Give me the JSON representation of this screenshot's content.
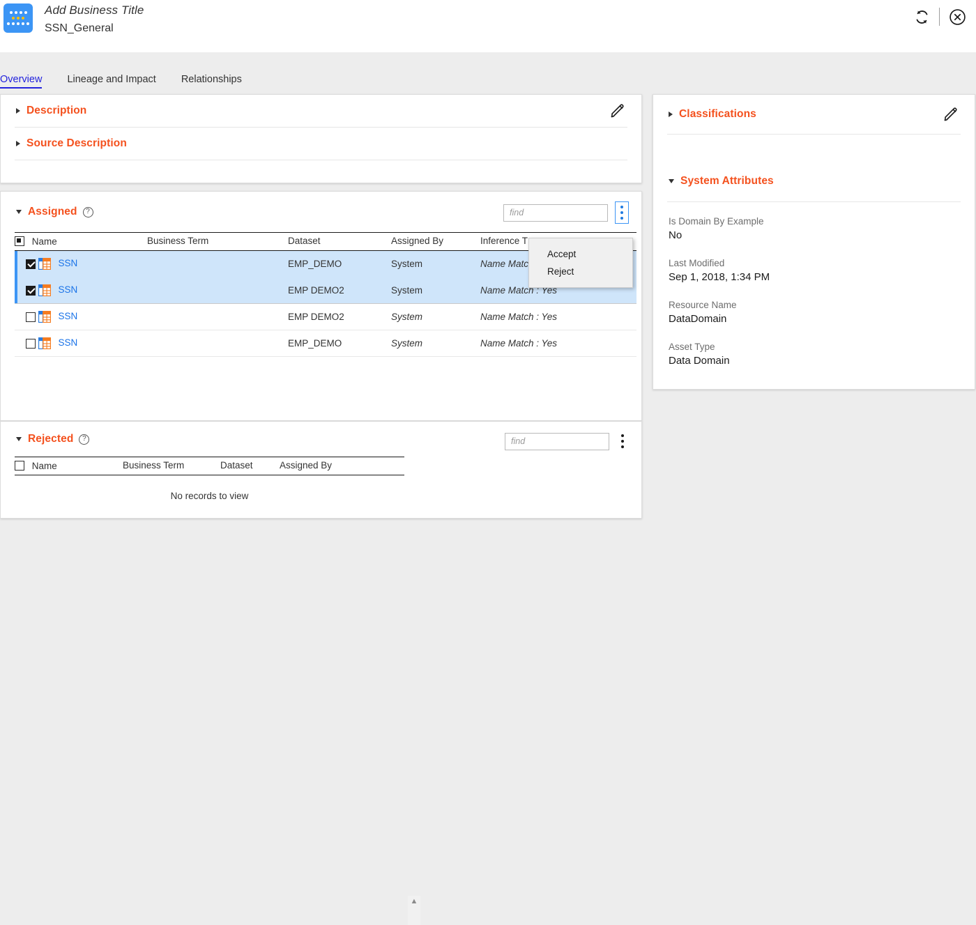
{
  "header": {
    "business_title": "Add Business Title",
    "asset_name": "SSN_General",
    "refresh_icon": "refresh-icon",
    "close_icon": "close-circle-icon"
  },
  "tabs": [
    {
      "label": "Overview",
      "active": true
    },
    {
      "label": "Lineage and Impact",
      "active": false
    },
    {
      "label": "Relationships",
      "active": false
    }
  ],
  "description_panel": {
    "sections": [
      {
        "label": "Description",
        "expanded": false
      },
      {
        "label": "Source Description",
        "expanded": false
      }
    ],
    "edit_icon": "pencil-icon"
  },
  "assigned": {
    "title": "Assigned",
    "expanded": true,
    "help_icon": "help-circle-icon",
    "find_placeholder": "find",
    "find_value": "",
    "kebab_icon": "kebab-menu-icon",
    "kebab_active": true,
    "header_checkbox_state": "indeterminate",
    "columns": [
      "Name",
      "Business Term",
      "Dataset",
      "Assigned By",
      "Inference T"
    ],
    "rows": [
      {
        "checked": true,
        "selected": true,
        "name": "SSN",
        "business_term": "",
        "dataset": "EMP_DEMO",
        "assigned_by": "System",
        "assigned_by_italic": false,
        "inference": "Name Match : Yes",
        "icon": "table-column-icon"
      },
      {
        "checked": true,
        "selected": true,
        "name": "SSN",
        "business_term": "",
        "dataset": "EMP DEMO2",
        "assigned_by": "System",
        "assigned_by_italic": false,
        "inference": "Name Match : Yes",
        "icon": "table-column-icon"
      },
      {
        "checked": false,
        "selected": false,
        "name": "SSN",
        "business_term": "",
        "dataset": "EMP DEMO2",
        "assigned_by": "System",
        "assigned_by_italic": true,
        "inference": "Name Match : Yes",
        "icon": "table-column-icon"
      },
      {
        "checked": false,
        "selected": false,
        "name": "SSN",
        "business_term": "",
        "dataset": "EMP_DEMO",
        "assigned_by": "System",
        "assigned_by_italic": true,
        "inference": "Name Match : Yes",
        "icon": "table-column-icon"
      }
    ]
  },
  "context_menu": {
    "items": [
      {
        "label": "Accept"
      },
      {
        "label": "Reject"
      }
    ]
  },
  "rejected": {
    "title": "Rejected",
    "expanded": true,
    "help_icon": "help-circle-icon",
    "find_placeholder": "find",
    "find_value": "",
    "kebab_icon": "kebab-menu-icon",
    "header_checkbox_state": "unchecked",
    "columns": [
      "Name",
      "Business Term",
      "Dataset",
      "Assigned By"
    ],
    "empty_message": "No records to view",
    "scroll_up_icon": "chevron-up-icon"
  },
  "sidebar": {
    "classifications": {
      "label": "Classifications",
      "expanded": false,
      "edit_icon": "pencil-icon"
    },
    "system_attributes": {
      "label": "System Attributes",
      "expanded": true,
      "attributes": [
        {
          "label": "Is Domain By Example",
          "value": "No"
        },
        {
          "label": "Last Modified",
          "value": "Sep 1, 2018, 1:34 PM"
        },
        {
          "label": "Resource Name",
          "value": "DataDomain"
        },
        {
          "label": "Asset Type",
          "value": "Data Domain"
        }
      ]
    }
  },
  "colors": {
    "accent_orange": "#f4511e",
    "link_blue": "#1a73e8",
    "tab_active_blue": "#2222dd",
    "selection_blue": "#cfe5fa",
    "logo_blue": "#3c95f5",
    "logo_amber": "#ffc107",
    "page_bg": "#ededed"
  }
}
